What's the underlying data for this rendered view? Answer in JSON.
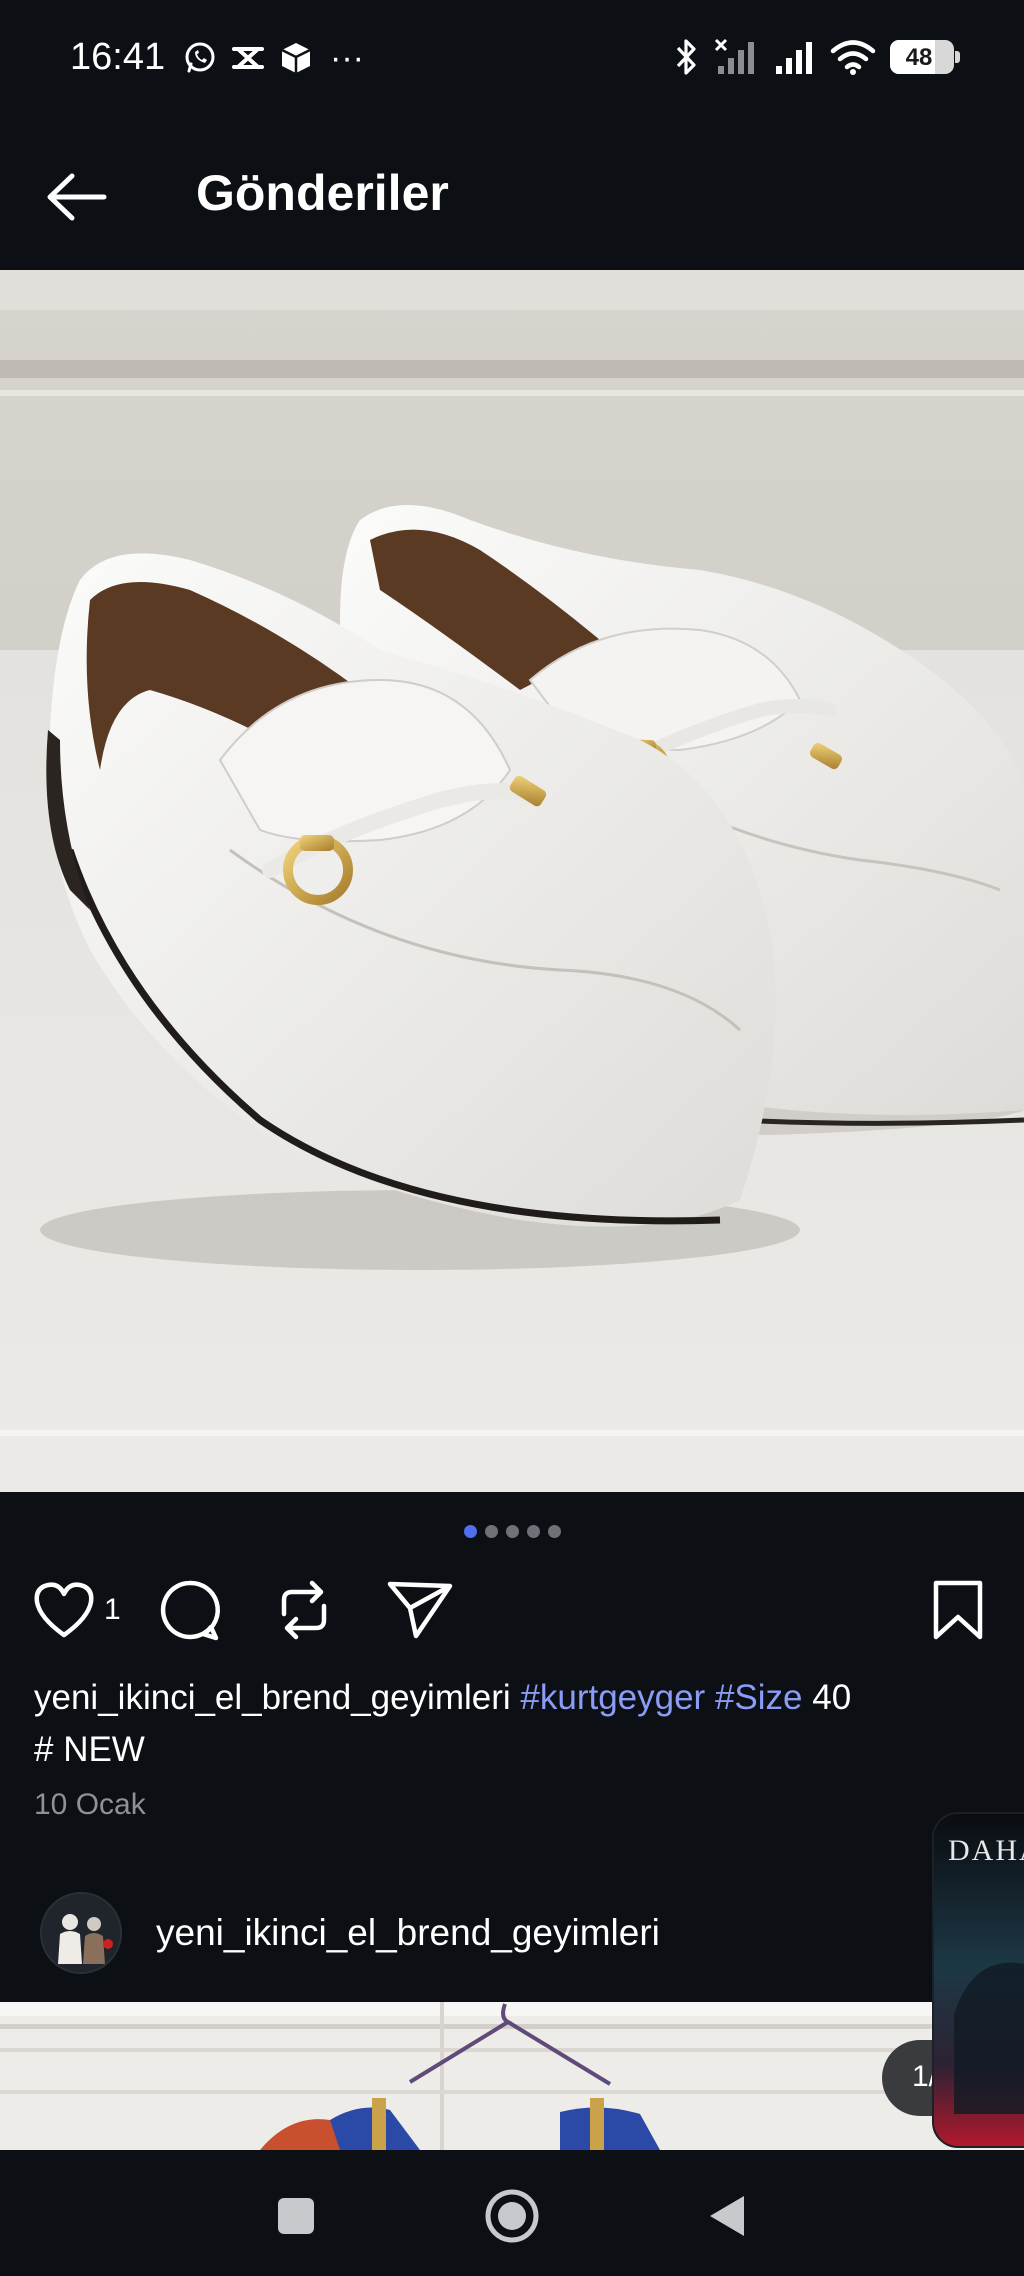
{
  "status_bar": {
    "time": "16:41",
    "left_icons": [
      "whatsapp-icon",
      "app-notification-icon",
      "package-icon"
    ],
    "more": "···",
    "battery": "48"
  },
  "header": {
    "title": "Gönderiler",
    "back_icon": "arrow-left-icon"
  },
  "post": {
    "image_count": 5,
    "active_index": 0,
    "likes": "1",
    "caption": {
      "username": "yeni_ikinci_el_brend_geyimleri",
      "tag1": "#kurtgeyger",
      "tag2": "#Size",
      "tail1": "40",
      "line2": "# NEW"
    },
    "date": "10 Ocak"
  },
  "next_post": {
    "username": "yeni_ikinci_el_brend_geyimleri",
    "counter": "1/"
  },
  "ad": {
    "text": "DAHA"
  },
  "colors": {
    "background": "#0c0f14",
    "hashtag": "#8b9cf7",
    "active_dot": "#4f6ef0",
    "date": "#8e9198"
  }
}
